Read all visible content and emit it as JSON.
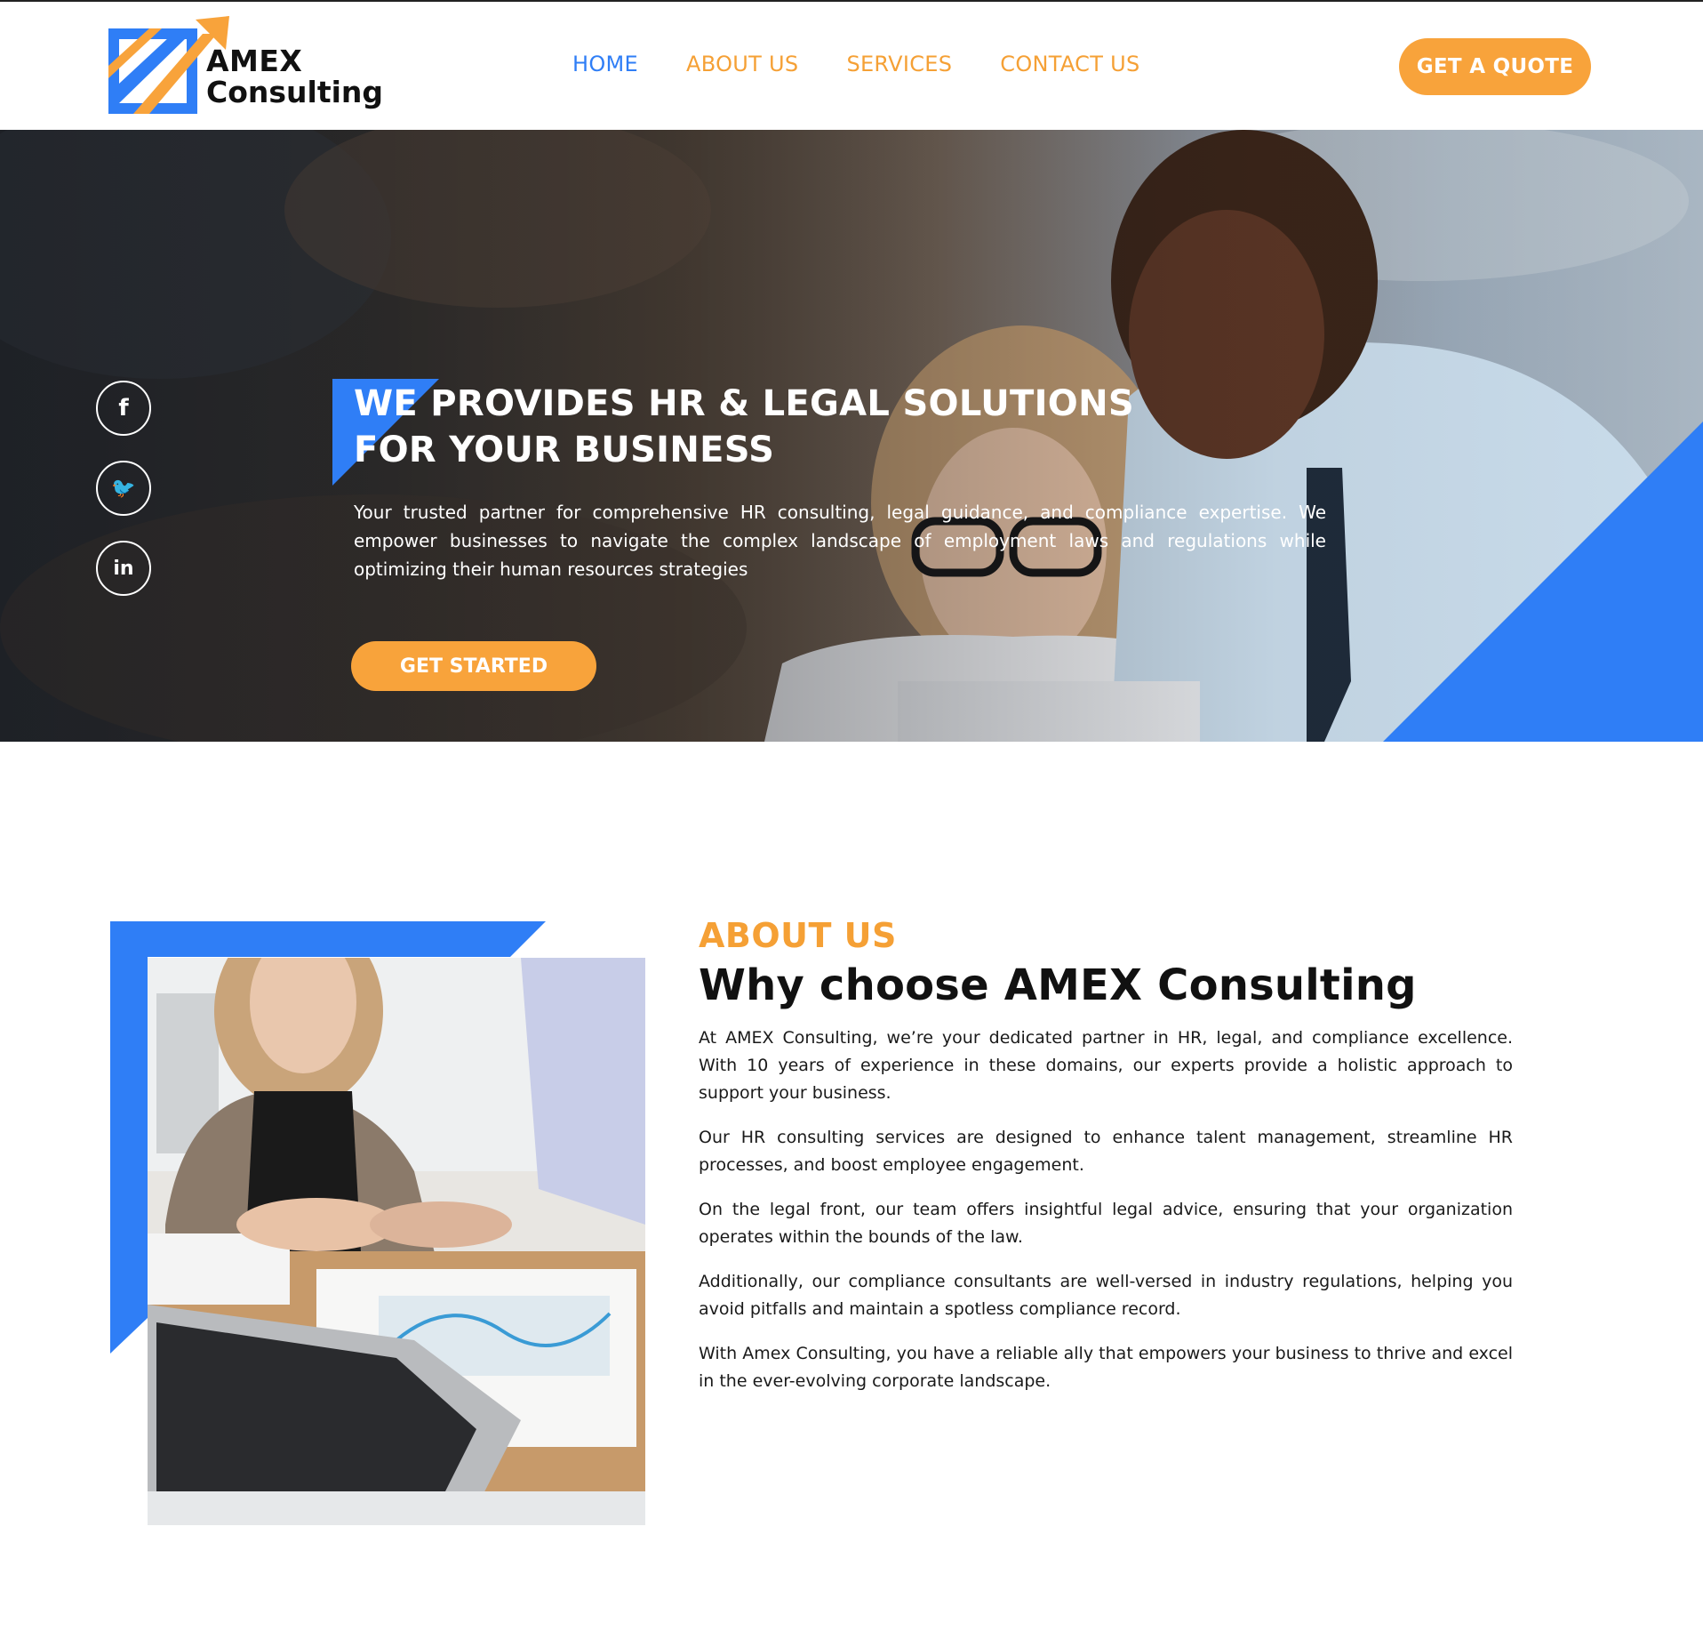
{
  "brand": {
    "name_line1": "AMEX",
    "name_line2": "Consulting",
    "colors": {
      "blue": "#2f7ef6",
      "orange": "#f8a33b",
      "dark": "#111111"
    }
  },
  "nav": {
    "items": [
      {
        "label": "HOME",
        "active": true
      },
      {
        "label": "ABOUT US",
        "active": false
      },
      {
        "label": "SERVICES",
        "active": false
      },
      {
        "label": "CONTACT US",
        "active": false
      }
    ],
    "cta_label": "GET A QUOTE"
  },
  "hero": {
    "title_line1": "WE PROVIDES HR & LEGAL SOLUTIONS",
    "title_line2": "FOR YOUR BUSINESS",
    "description": "Your trusted partner for comprehensive HR consulting, legal guidance, and compliance expertise. We empower businesses to navigate the complex landscape of employment laws and regulations while optimizing their human resources strategies",
    "button_label": "GET STARTED",
    "social": [
      {
        "icon": "facebook-icon",
        "glyph": "f"
      },
      {
        "icon": "twitter-icon",
        "glyph": "🐦"
      },
      {
        "icon": "linkedin-icon",
        "glyph": "in"
      }
    ]
  },
  "about": {
    "kicker": "ABOUT US",
    "title": "Why choose AMEX Consulting",
    "paragraphs": [
      "At AMEX Consulting, we’re your dedicated partner in HR, legal, and compliance excellence. With 10 years of experience in these domains, our experts provide a holistic approach to support your business.",
      "Our HR consulting services are designed to enhance talent management, streamline HR processes, and boost employee engagement.",
      "On the legal front, our team offers insightful legal advice, ensuring that your organization operates within the bounds of the law.",
      "Additionally, our compliance consultants are well-versed in industry regulations, helping you avoid pitfalls and maintain a spotless compliance record.",
      "With Amex Consulting, you have a reliable ally that empowers your business to thrive and excel in the ever-evolving corporate landscape."
    ]
  }
}
